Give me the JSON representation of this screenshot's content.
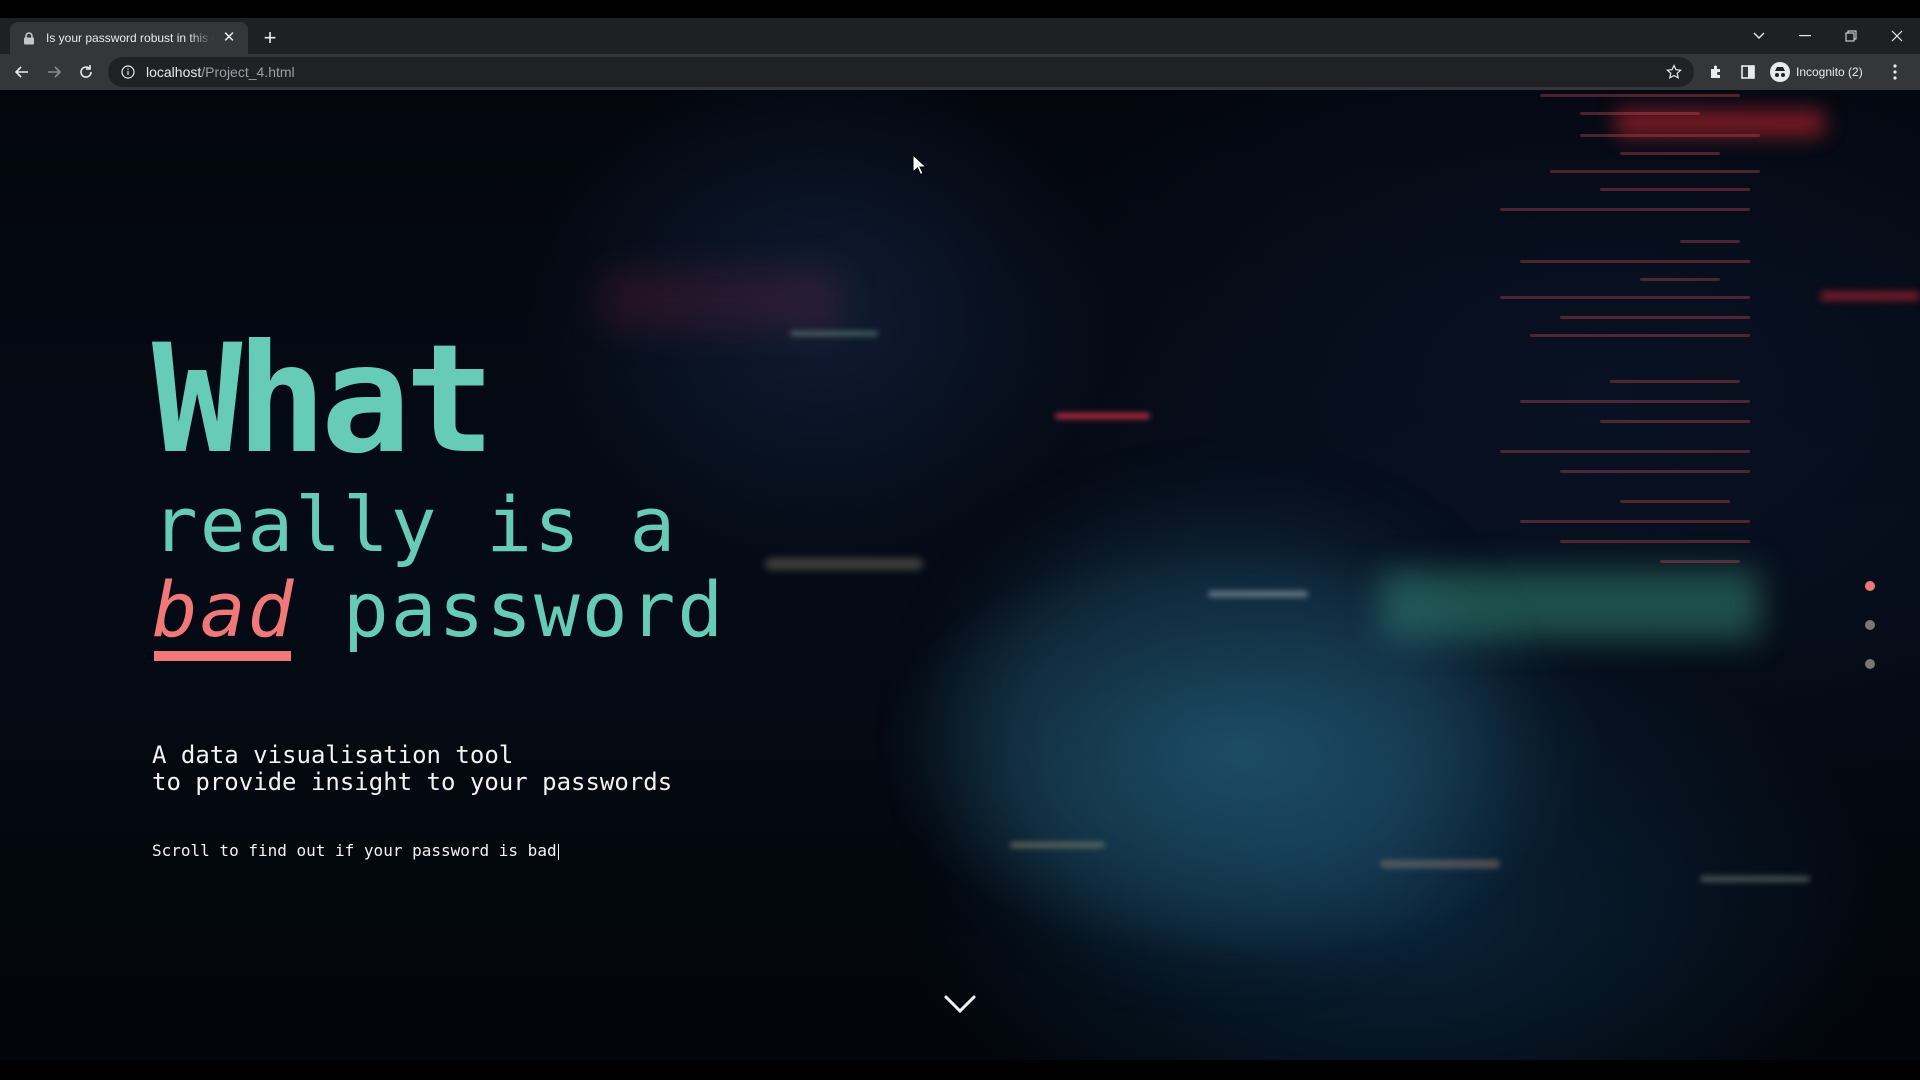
{
  "browser": {
    "tab": {
      "title": "Is your password robust in this d",
      "favicon": "lock-icon"
    },
    "new_tab_label": "+",
    "url_host": "localhost",
    "url_path": "/Project_4.html",
    "profile_label": "Incognito (2)"
  },
  "hero": {
    "word1": "What",
    "line2": "really is a",
    "bad_word": "bad",
    "line3_rest": " password",
    "subtitle_line1": "A data visualisation tool",
    "subtitle_line2": "to provide insight to your passwords",
    "scroll_hint": "Scroll to find out if your password is bad"
  },
  "pager": {
    "count": 3,
    "active_index": 0
  },
  "colors": {
    "accent_teal": "#66ccb7",
    "accent_red": "#f07878",
    "text_light": "#f3f3f3"
  }
}
